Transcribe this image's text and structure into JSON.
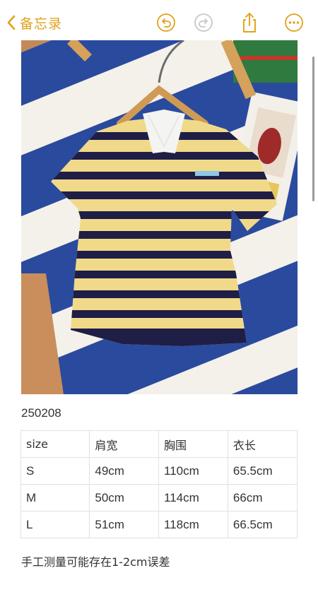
{
  "nav": {
    "back_label": "备忘录",
    "back_icon": "chevron-left-icon",
    "undo_icon": "undo-icon",
    "redo_icon": "redo-icon",
    "share_icon": "share-icon",
    "more_icon": "more-icon",
    "accent_color": "#e0a21a",
    "disabled_color": "#c7c7c7"
  },
  "note": {
    "item_code": "250208",
    "size_table": {
      "headers": [
        "size",
        "肩宽",
        "胸围",
        "衣长"
      ],
      "rows": [
        [
          "S",
          "49cm",
          "110cm",
          "65.5cm"
        ],
        [
          "M",
          "50cm",
          "114cm",
          "66cm"
        ],
        [
          "L",
          "51cm",
          "118cm",
          "66.5cm"
        ]
      ]
    },
    "disclaimer": "手工测量可能存在1-2cm误差"
  }
}
